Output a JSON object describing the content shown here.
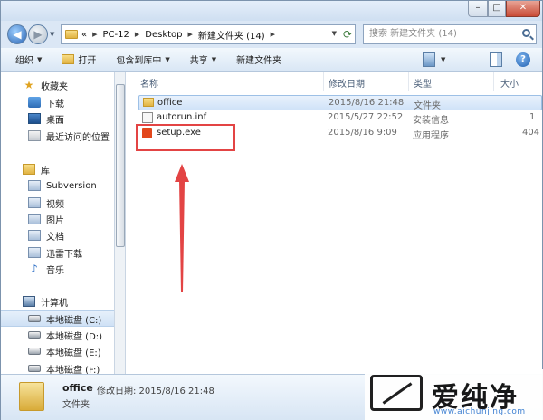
{
  "address": {
    "segments": [
      "PC-12",
      "Desktop",
      "新建文件夹 (14)"
    ],
    "prefix": "«"
  },
  "search": {
    "placeholder": "搜索 新建文件夹 (14)"
  },
  "toolbar": {
    "organize": "组织",
    "open": "打开",
    "include_library": "包含到库中",
    "share": "共享",
    "new_folder": "新建文件夹"
  },
  "nav": {
    "favorites": "收藏夹",
    "downloads": "下载",
    "desktop": "桌面",
    "recent": "最近访问的位置",
    "libraries": "库",
    "subversion": "Subversion",
    "videos": "视频",
    "pictures": "图片",
    "documents": "文档",
    "thunder": "迅雷下载",
    "music": "音乐",
    "computer": "计算机",
    "drives": [
      "本地磁盘 (C:)",
      "本地磁盘 (D:)",
      "本地磁盘 (E:)",
      "本地磁盘 (F:)"
    ]
  },
  "columns": {
    "name": "名称",
    "modified": "修改日期",
    "type": "类型",
    "size": "大小"
  },
  "files": [
    {
      "name": "office",
      "modified": "2015/8/16 21:48",
      "type": "文件夹",
      "size": "",
      "icon": "folder-icon"
    },
    {
      "name": "autorun.inf",
      "modified": "2015/5/27 22:52",
      "type": "安装信息",
      "size": "1",
      "icon": "inf-file-icon"
    },
    {
      "name": "setup.exe",
      "modified": "2015/8/16 9:09",
      "type": "应用程序",
      "size": "404",
      "icon": "office-setup-icon"
    }
  ],
  "status": {
    "name": "office",
    "meta": "修改日期: 2015/8/16 21:48",
    "type": "文件夹"
  },
  "watermark": {
    "brand": "爱纯净",
    "url": "www.aichunjing.com"
  },
  "colors": {
    "highlight_box": "#e34444",
    "arrow": "#e34444",
    "selection": "#cfe1f5"
  }
}
